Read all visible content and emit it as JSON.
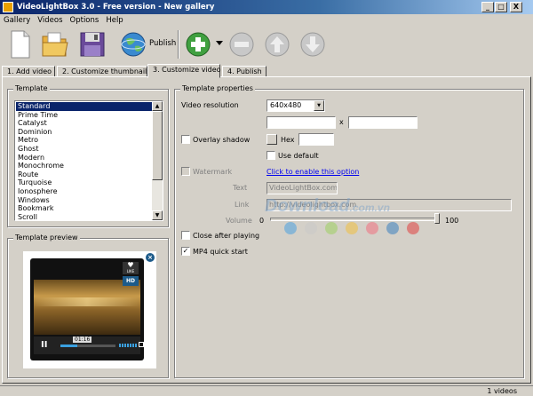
{
  "window": {
    "title": "VideoLightBox 3.0 - Free version - New gallery",
    "min": "_",
    "max": "□",
    "close": "X"
  },
  "menu": [
    "Gallery",
    "Videos",
    "Options",
    "Help"
  ],
  "toolbar": {
    "publish_label": "Publish"
  },
  "tabs": [
    "1. Add video",
    "2. Customize thumbnails",
    "3. Customize video",
    "4. Publish"
  ],
  "template": {
    "title": "Template",
    "items": [
      "Standard",
      "Prime Time",
      "Catalyst",
      "Dominion",
      "Metro",
      "Ghost",
      "Modern",
      "Monochrome",
      "Route",
      "Turquoise",
      "Ionosphere",
      "Windows",
      "Bookmark",
      "Scroll"
    ],
    "selected": "Standard"
  },
  "preview": {
    "title": "Template preview",
    "time": "01:16",
    "like": "♥",
    "like_label": "LIKE",
    "hd": "HD",
    "progress_fraction": 0.3
  },
  "properties": {
    "title": "Template properties",
    "resolution_label": "Video resolution",
    "resolution_value": "640x480",
    "times": "x",
    "overlay_label": "Overlay shadow",
    "hex_label": "Hex",
    "use_default_label": "Use default",
    "watermark_label": "Watermark",
    "enable_link": "Click to enable this option",
    "text_label": "Text",
    "text_value": "VideoLightBox.com",
    "link_label": "Link",
    "link_value": "http://videolightbox.com",
    "volume_label": "Volume",
    "volume_min": "0",
    "volume_max": "100",
    "volume_value": 100,
    "close_after_label": "Close after playing",
    "mp4_label": "MP4 quick start",
    "mp4_checked": "✓"
  },
  "status": {
    "count": "1 videos"
  },
  "watermark": {
    "brand": "Download",
    "suffix": ".com.vn"
  },
  "colors": {
    "dots": [
      "#4aa0e0",
      "#c8c8c8",
      "#9cd060",
      "#f0c040",
      "#f07080",
      "#3a80c0",
      "#e04040"
    ]
  }
}
